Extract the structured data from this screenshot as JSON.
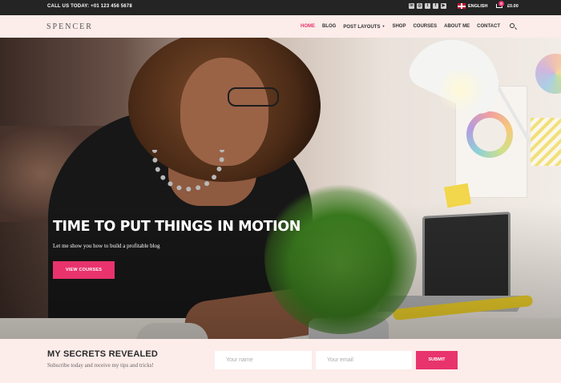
{
  "topbar": {
    "call_text": "CALL US TODAY: +01 123 456 5678",
    "social_icons": [
      "linkedin-icon",
      "instagram-icon",
      "twitter-icon",
      "facebook-icon",
      "youtube-icon"
    ],
    "language": "ENGLISH",
    "cart_count": "0",
    "cart_total": "£0.00"
  },
  "nav": {
    "logo": "SPENCER",
    "items": [
      {
        "label": "HOME",
        "active": true
      },
      {
        "label": "BLOG"
      },
      {
        "label": "POST LAYOUTS",
        "dropdown": true
      },
      {
        "label": "SHOP"
      },
      {
        "label": "COURSES"
      },
      {
        "label": "ABOUT ME"
      },
      {
        "label": "CONTACT"
      }
    ]
  },
  "hero": {
    "title": "TIME TO PUT THINGS IN MOTION",
    "subtitle": "Let me show you how to build a profitable blog",
    "button_label": "VIEW COURSES"
  },
  "subscribe": {
    "title": "MY SECRETS REVEALED",
    "text": "Subscribe today and receive my tips and tricks!",
    "name_placeholder": "Your name",
    "email_placeholder": "Your email",
    "submit_label": "SUBMIT"
  },
  "colors": {
    "accent": "#e8336d",
    "topbar": "#242424",
    "band": "#fcecea"
  }
}
